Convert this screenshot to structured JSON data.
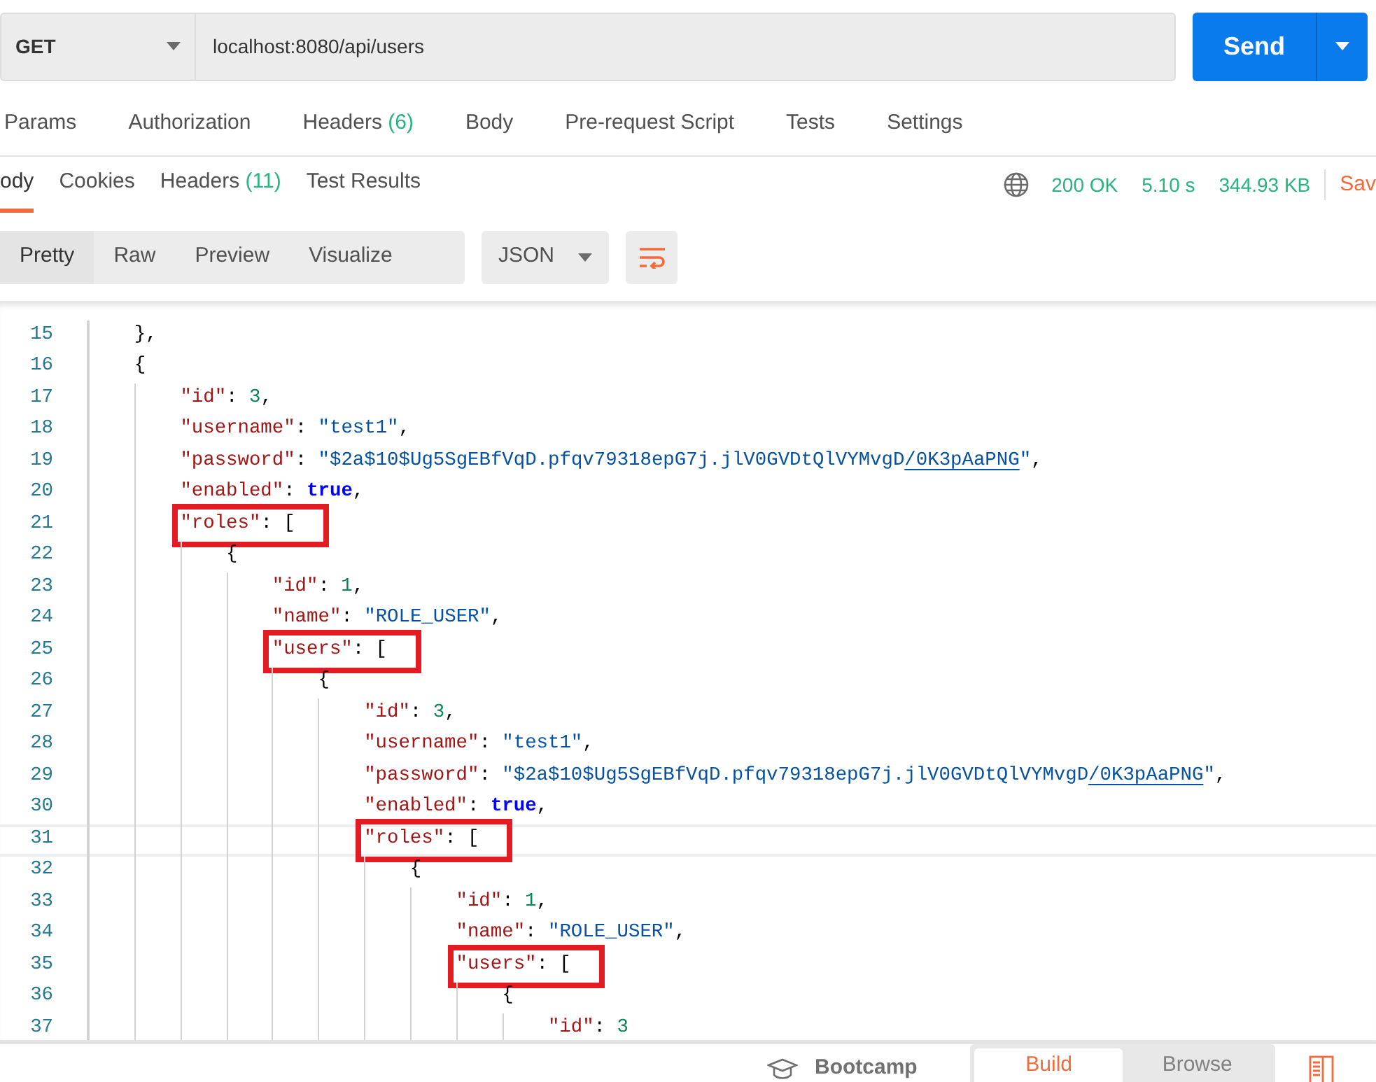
{
  "request": {
    "method": "GET",
    "url": "localhost:8080/api/users",
    "send": "Send"
  },
  "request_tabs": [
    {
      "label": "Params"
    },
    {
      "label": "Authorization"
    },
    {
      "label": "Headers",
      "count": "(6)"
    },
    {
      "label": "Body"
    },
    {
      "label": "Pre-request Script"
    },
    {
      "label": "Tests"
    },
    {
      "label": "Settings"
    }
  ],
  "response_tabs": [
    {
      "label": "ody",
      "selected": true
    },
    {
      "label": "Cookies",
      "selected": false
    },
    {
      "label": "Headers",
      "count": "(11)",
      "selected": false
    },
    {
      "label": "Test Results",
      "selected": false
    }
  ],
  "status": {
    "code": "200 OK",
    "time": "5.10 s",
    "size": "344.93 KB",
    "save": "Sav"
  },
  "view_modes": [
    {
      "label": "Pretty",
      "selected": true
    },
    {
      "label": "Raw",
      "selected": false
    },
    {
      "label": "Preview",
      "selected": false
    },
    {
      "label": "Visualize",
      "selected": false
    }
  ],
  "format": "JSON",
  "code_lines": [
    {
      "number": "15",
      "tokens": [
        {
          "kind": "punct",
          "text": "},"
        }
      ]
    },
    {
      "number": "16",
      "tokens": [
        {
          "kind": "punct",
          "text": "{"
        }
      ],
      "children": [
        {
          "number": "17",
          "tokens": [
            {
              "kind": "key",
              "text": "\"id\""
            },
            {
              "kind": "punct",
              "text": ": "
            },
            {
              "kind": "number",
              "text": "3"
            },
            {
              "kind": "punct",
              "text": ","
            }
          ]
        },
        {
          "number": "18",
          "tokens": [
            {
              "kind": "key",
              "text": "\"username\""
            },
            {
              "kind": "punct",
              "text": ": "
            },
            {
              "kind": "string",
              "text": "\"test1\""
            },
            {
              "kind": "punct",
              "text": ","
            }
          ]
        },
        {
          "number": "19",
          "tokens": [
            {
              "kind": "key",
              "text": "\"password\""
            },
            {
              "kind": "punct",
              "text": ": "
            },
            {
              "kind": "string",
              "text": "\"$2a$10$Ug5SgEBfVqD.pfqv79318epG7j.jlV0GVDtQlVYMvgD"
            },
            {
              "kind": "link",
              "text": "/0K3pAaPNG"
            },
            {
              "kind": "string",
              "text": "\""
            },
            {
              "kind": "punct",
              "text": ","
            }
          ]
        },
        {
          "number": "20",
          "tokens": [
            {
              "kind": "key",
              "text": "\"enabled\""
            },
            {
              "kind": "punct",
              "text": ": "
            },
            {
              "kind": "bool",
              "text": "true"
            },
            {
              "kind": "punct",
              "text": ","
            }
          ]
        },
        {
          "number": "21",
          "tokens": [
            {
              "kind": "key",
              "text": "\"roles\"",
              "boxed": true
            },
            {
              "kind": "punct",
              "text": ": [",
              "boxed": true
            }
          ],
          "children": [
            {
              "number": "22",
              "tokens": [
                {
                  "kind": "punct",
                  "text": "{"
                }
              ],
              "children": [
                {
                  "number": "23",
                  "tokens": [
                    {
                      "kind": "key",
                      "text": "\"id\""
                    },
                    {
                      "kind": "punct",
                      "text": ": "
                    },
                    {
                      "kind": "number",
                      "text": "1"
                    },
                    {
                      "kind": "punct",
                      "text": ","
                    }
                  ]
                },
                {
                  "number": "24",
                  "tokens": [
                    {
                      "kind": "key",
                      "text": "\"name\""
                    },
                    {
                      "kind": "punct",
                      "text": ": "
                    },
                    {
                      "kind": "string",
                      "text": "\"ROLE_USER\""
                    },
                    {
                      "kind": "punct",
                      "text": ","
                    }
                  ]
                },
                {
                  "number": "25",
                  "tokens": [
                    {
                      "kind": "key",
                      "text": "\"users\"",
                      "boxed": true
                    },
                    {
                      "kind": "punct",
                      "text": ": [",
                      "boxed": true
                    }
                  ],
                  "children": [
                    {
                      "number": "26",
                      "tokens": [
                        {
                          "kind": "punct",
                          "text": "{"
                        }
                      ],
                      "children": [
                        {
                          "number": "27",
                          "tokens": [
                            {
                              "kind": "key",
                              "text": "\"id\""
                            },
                            {
                              "kind": "punct",
                              "text": ": "
                            },
                            {
                              "kind": "number",
                              "text": "3"
                            },
                            {
                              "kind": "punct",
                              "text": ","
                            }
                          ]
                        },
                        {
                          "number": "28",
                          "tokens": [
                            {
                              "kind": "key",
                              "text": "\"username\""
                            },
                            {
                              "kind": "punct",
                              "text": ": "
                            },
                            {
                              "kind": "string",
                              "text": "\"test1\""
                            },
                            {
                              "kind": "punct",
                              "text": ","
                            }
                          ]
                        },
                        {
                          "number": "29",
                          "tokens": [
                            {
                              "kind": "key",
                              "text": "\"password\""
                            },
                            {
                              "kind": "punct",
                              "text": ": "
                            },
                            {
                              "kind": "string",
                              "text": "\"$2a$10$Ug5SgEBfVqD.pfqv79318epG7j.jlV0GVDtQlVYMvgD"
                            },
                            {
                              "kind": "link",
                              "text": "/0K3pAaPNG"
                            },
                            {
                              "kind": "string",
                              "text": "\""
                            },
                            {
                              "kind": "punct",
                              "text": ","
                            }
                          ]
                        },
                        {
                          "number": "30",
                          "tokens": [
                            {
                              "kind": "key",
                              "text": "\"enabled\""
                            },
                            {
                              "kind": "punct",
                              "text": ": "
                            },
                            {
                              "kind": "bool",
                              "text": "true"
                            },
                            {
                              "kind": "punct",
                              "text": ","
                            }
                          ]
                        },
                        {
                          "number": "31",
                          "current": true,
                          "tokens": [
                            {
                              "kind": "key",
                              "text": "\"roles\"",
                              "boxed": true
                            },
                            {
                              "kind": "punct",
                              "text": ": [",
                              "boxed": true
                            }
                          ],
                          "children": [
                            {
                              "number": "32",
                              "tokens": [
                                {
                                  "kind": "punct",
                                  "text": "{"
                                }
                              ],
                              "children": [
                                {
                                  "number": "33",
                                  "tokens": [
                                    {
                                      "kind": "key",
                                      "text": "\"id\""
                                    },
                                    {
                                      "kind": "punct",
                                      "text": ": "
                                    },
                                    {
                                      "kind": "number",
                                      "text": "1"
                                    },
                                    {
                                      "kind": "punct",
                                      "text": ","
                                    }
                                  ]
                                },
                                {
                                  "number": "34",
                                  "tokens": [
                                    {
                                      "kind": "key",
                                      "text": "\"name\""
                                    },
                                    {
                                      "kind": "punct",
                                      "text": ": "
                                    },
                                    {
                                      "kind": "string",
                                      "text": "\"ROLE_USER\""
                                    },
                                    {
                                      "kind": "punct",
                                      "text": ","
                                    }
                                  ]
                                },
                                {
                                  "number": "35",
                                  "tokens": [
                                    {
                                      "kind": "key",
                                      "text": "\"users\"",
                                      "boxed": true
                                    },
                                    {
                                      "kind": "punct",
                                      "text": ": [",
                                      "boxed": true
                                    }
                                  ],
                                  "children": [
                                    {
                                      "number": "36",
                                      "tokens": [
                                        {
                                          "kind": "punct",
                                          "text": "{"
                                        }
                                      ],
                                      "children": [
                                        {
                                          "number": "37",
                                          "tokens": [
                                            {
                                              "kind": "key",
                                              "text": "\"id\""
                                            },
                                            {
                                              "kind": "punct",
                                              "text": ": "
                                            },
                                            {
                                              "kind": "number",
                                              "text": "3"
                                            }
                                          ]
                                        }
                                      ]
                                    }
                                  ]
                                }
                              ]
                            }
                          ]
                        }
                      ]
                    }
                  ]
                }
              ]
            }
          ]
        }
      ]
    }
  ],
  "footer": {
    "bootcamp": "Bootcamp",
    "modes": [
      {
        "label": "Build",
        "selected": true
      },
      {
        "label": "Browse",
        "selected": false
      }
    ]
  }
}
